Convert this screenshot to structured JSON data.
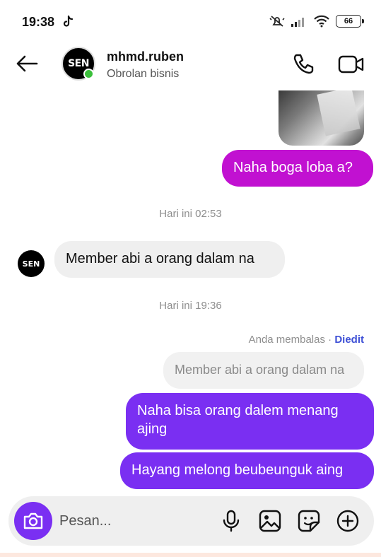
{
  "status_bar": {
    "time": "19:38",
    "battery": "66"
  },
  "header": {
    "avatar_text": "SEN",
    "contact_name": "mhmd.ruben",
    "contact_subtitle": "Obrolan bisnis"
  },
  "messages": {
    "msg1": "Naha boga loba a?",
    "timestamp1": "Hari ini 02:53",
    "msg2": "Member abi a orang dalam na",
    "timestamp2": "Hari ini 19:36",
    "reply_meta_prefix": "Anda membalas · ",
    "reply_meta_edited": "Diedit",
    "reply_quote": "Member abi a orang dalam na",
    "msg3": "Naha bisa orang dalem menang ajing",
    "msg4": "Hayang melong beubeunguk aing"
  },
  "composer": {
    "placeholder": "Pesan..."
  },
  "colors": {
    "magenta_bubble": "#c111d1",
    "purple_bubble": "#7a2ff2",
    "online": "#3bbf3b",
    "edited_link": "#3f51d6"
  }
}
